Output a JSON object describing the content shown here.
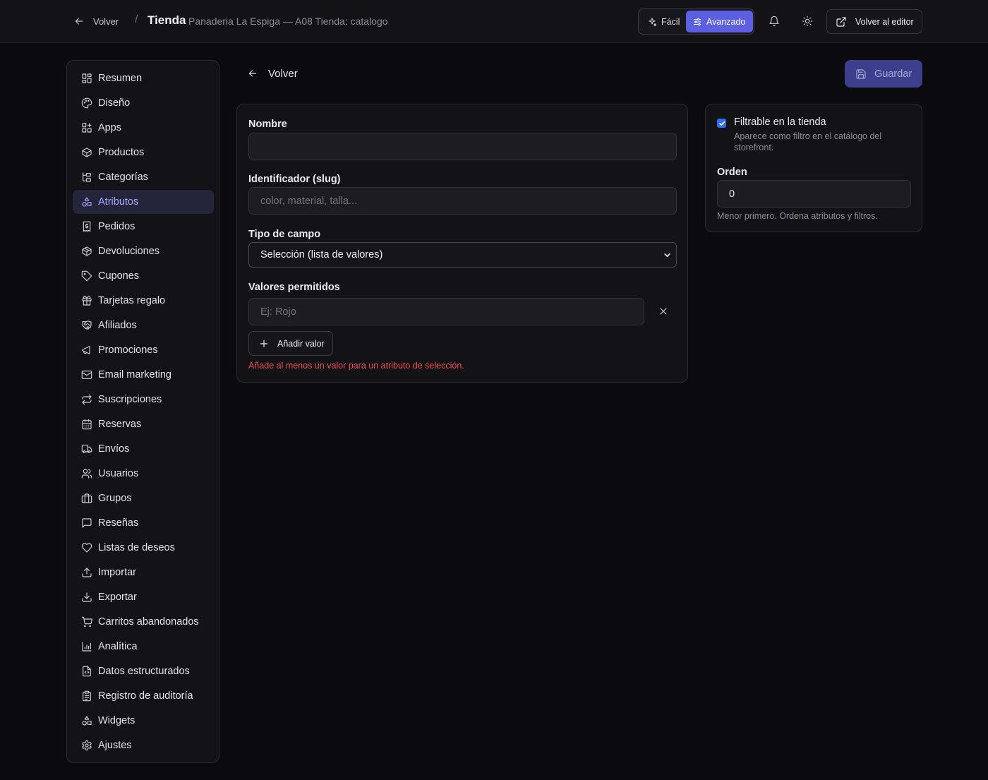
{
  "topbar": {
    "back_label": "Volver",
    "separator": "/",
    "title": "Tienda",
    "subtitle": "Panaderia La Espiga — A08 Tienda: catalogo",
    "mode_easy": "Fácil",
    "mode_advanced": "Avanzado",
    "editor_label": "Volver al editor"
  },
  "sidebar": {
    "items": [
      {
        "label": "Resumen",
        "icon": "dashboard-icon"
      },
      {
        "label": "Diseño",
        "icon": "palette-icon"
      },
      {
        "label": "Apps",
        "icon": "apps-icon"
      },
      {
        "label": "Productos",
        "icon": "package-icon"
      },
      {
        "label": "Categorías",
        "icon": "tree-icon"
      },
      {
        "label": "Atributos",
        "icon": "shapes-icon",
        "active": true
      },
      {
        "label": "Pedidos",
        "icon": "receipt-icon"
      },
      {
        "label": "Devoluciones",
        "icon": "package-return-icon"
      },
      {
        "label": "Cupones",
        "icon": "tag-icon"
      },
      {
        "label": "Tarjetas regalo",
        "icon": "gift-icon"
      },
      {
        "label": "Afiliados",
        "icon": "handshake-icon"
      },
      {
        "label": "Promociones",
        "icon": "megaphone-icon"
      },
      {
        "label": "Email marketing",
        "icon": "mail-icon"
      },
      {
        "label": "Suscripciones",
        "icon": "repeat-icon"
      },
      {
        "label": "Reservas",
        "icon": "calendar-icon"
      },
      {
        "label": "Envíos",
        "icon": "truck-icon"
      },
      {
        "label": "Usuarios",
        "icon": "users-icon"
      },
      {
        "label": "Grupos",
        "icon": "briefcase-icon"
      },
      {
        "label": "Reseñas",
        "icon": "message-icon"
      },
      {
        "label": "Listas de deseos",
        "icon": "heart-icon"
      },
      {
        "label": "Importar",
        "icon": "upload-icon"
      },
      {
        "label": "Exportar",
        "icon": "download-icon"
      },
      {
        "label": "Carritos abandonados",
        "icon": "cart-icon"
      },
      {
        "label": "Analítica",
        "icon": "bar-chart-icon"
      },
      {
        "label": "Datos estructurados",
        "icon": "file-code-icon"
      },
      {
        "label": "Registro de auditoría",
        "icon": "clipboard-icon"
      },
      {
        "label": "Widgets",
        "icon": "widgets-icon"
      },
      {
        "label": "Ajustes",
        "icon": "gear-icon"
      }
    ]
  },
  "main": {
    "back_label": "Volver",
    "save_label": "Guardar",
    "form": {
      "name_label": "Nombre",
      "name_value": "",
      "slug_label": "Identificador (slug)",
      "slug_placeholder": "color, material, talla...",
      "type_label": "Tipo de campo",
      "type_value": "Selección (lista de valores)",
      "values_label": "Valores permitidos",
      "value_placeholder": "Ej: Rojo",
      "add_value_label": "Añadir valor",
      "error_text": "Añade al menos un valor para un atributo de selección."
    },
    "side": {
      "filterable_label": "Filtrable en la tienda",
      "filterable_checked": true,
      "filterable_help": "Aparece como filtro en el catálogo del storefront.",
      "order_label": "Orden",
      "order_value": "0",
      "order_help": "Menor primero. Ordena atributos y filtros."
    }
  },
  "colors": {
    "accent": "#5b5fe0",
    "active_nav_text": "#a6a8ff",
    "error": "#f05252",
    "background": "#0b0b0f"
  }
}
